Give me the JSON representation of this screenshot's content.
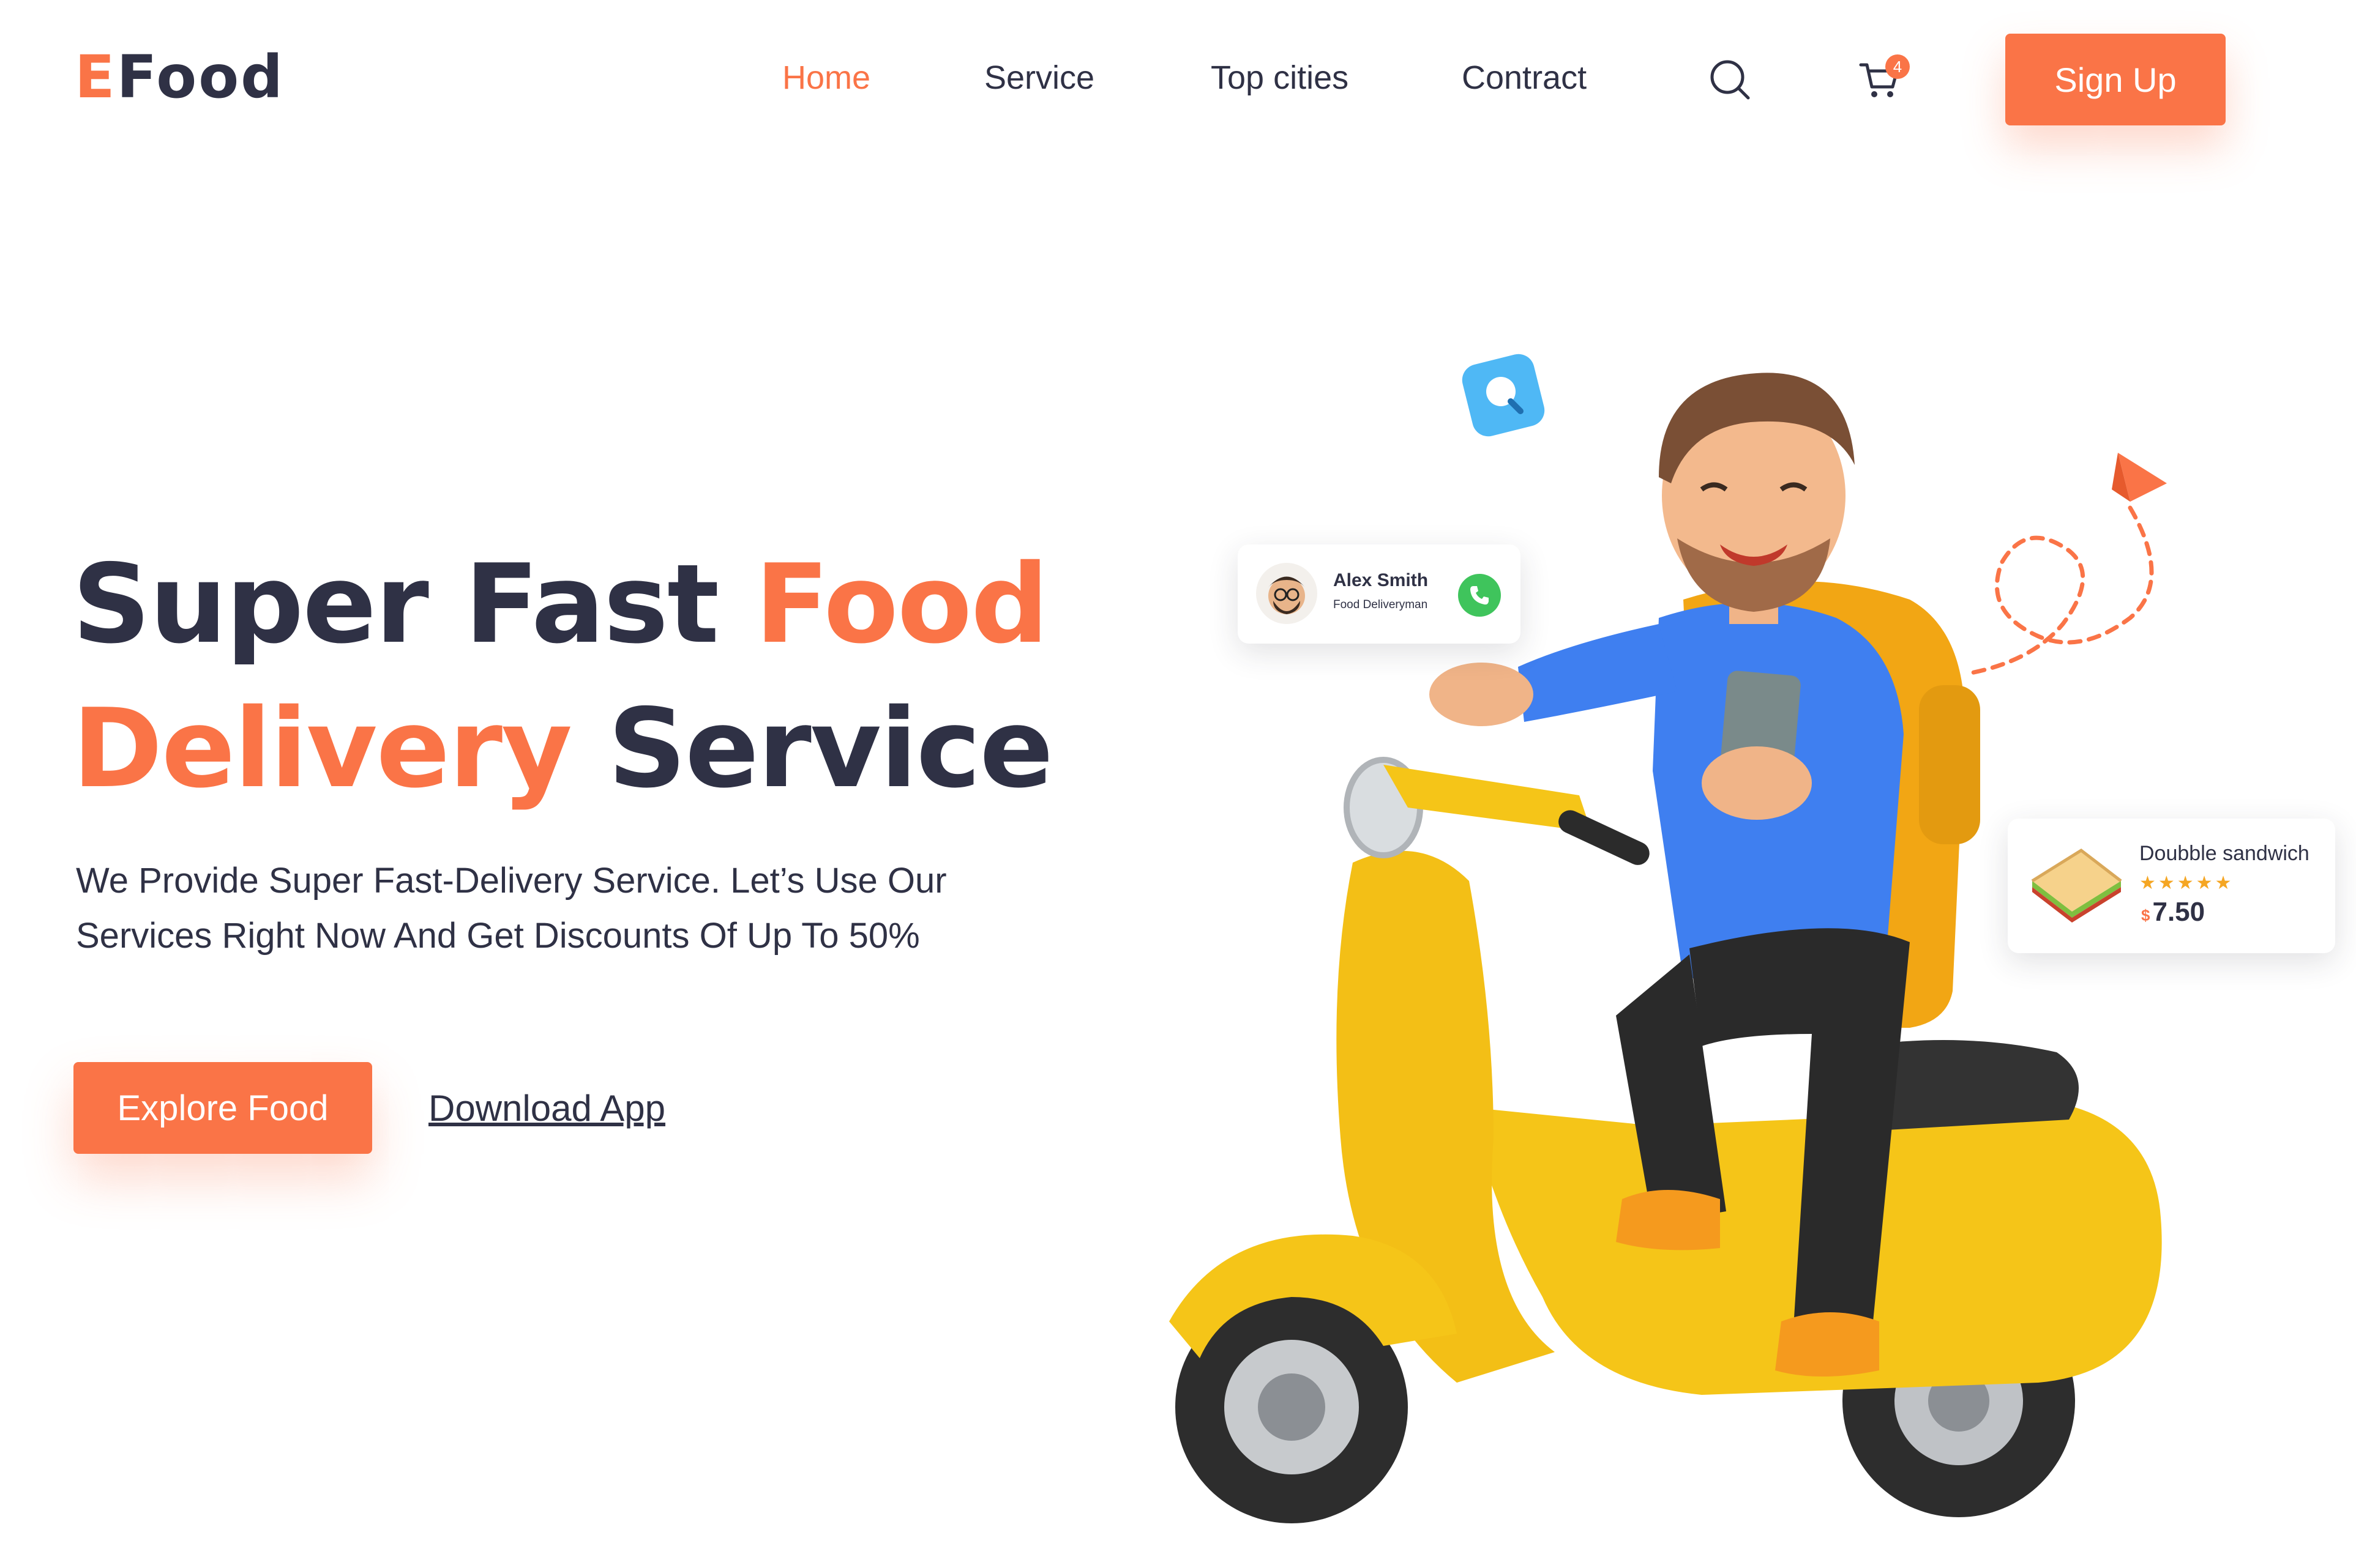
{
  "nav": {
    "logo_first": "E",
    "logo_rest": "Food",
    "links": [
      {
        "label": "Home",
        "active": true
      },
      {
        "label": "Service",
        "active": false
      },
      {
        "label": "Top cities",
        "active": false
      },
      {
        "label": "Contract",
        "active": false
      }
    ],
    "search_icon": "search-icon",
    "cart_icon": "cart-icon",
    "cart_count": "4",
    "signup_label": "Sign Up"
  },
  "hero": {
    "title_part1": "Super Fast ",
    "title_part2": "Food",
    "title_part3": "Delivery",
    "title_part4": " Service",
    "subtitle_line1": "We Provide Super Fast-Delivery Service. Let’s Use Our",
    "subtitle_line2": "Services Right Now And Get Discounts Of Up To 50%",
    "explore_label": "Explore Food",
    "download_label": "Download App"
  },
  "courier_card": {
    "name": "Alex Smith",
    "role": "Food Deliveryman",
    "call_icon": "phone-icon"
  },
  "food_card": {
    "name": "Doubble sandwich",
    "stars": "★★★★★",
    "rating": 4.5,
    "currency": "$",
    "price": "7.50"
  },
  "colors": {
    "accent": "#fa7447",
    "text": "#2f3145",
    "scooter": "#f5c518",
    "call": "#3fc45c",
    "search_bubble": "#4fb8f5"
  }
}
